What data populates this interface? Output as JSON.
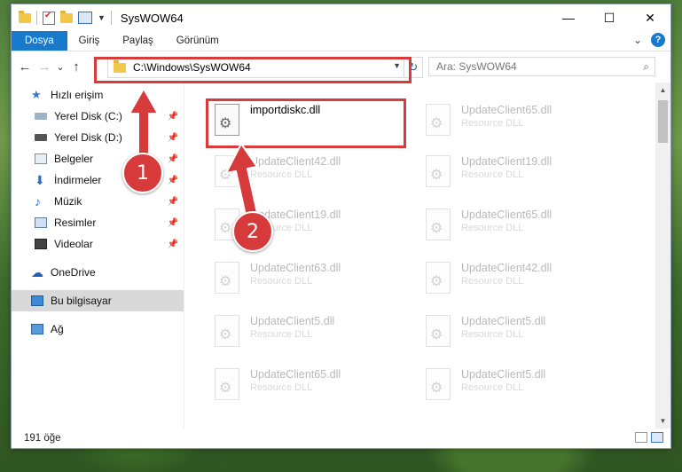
{
  "window": {
    "title": "SysWOW64",
    "controls": {
      "minimize": "—",
      "maximize": "☐",
      "close": "✕"
    }
  },
  "ribbon": {
    "tabs": [
      "Dosya",
      "Giriş",
      "Paylaş",
      "Görünüm"
    ],
    "collapse": "⌄",
    "help": "?"
  },
  "nav": {
    "back": "←",
    "forward": "→",
    "recent": "⌄",
    "up": "↑",
    "address": "C:\\Windows\\SysWOW64",
    "search_placeholder": "Ara: SysWOW64"
  },
  "sidebar": {
    "items": [
      {
        "label": "Hızlı erişim",
        "icon": "star-icon",
        "pinned": false
      },
      {
        "label": "Yerel Disk (C:)",
        "icon": "drive-icon",
        "pinned": true
      },
      {
        "label": "Yerel Disk (D:)",
        "icon": "drive-icon",
        "pinned": true
      },
      {
        "label": "Belgeler",
        "icon": "documents-icon",
        "pinned": true
      },
      {
        "label": "İndirmeler",
        "icon": "download-icon",
        "pinned": true
      },
      {
        "label": "Müzik",
        "icon": "music-icon",
        "pinned": true
      },
      {
        "label": "Resimler",
        "icon": "pictures-icon",
        "pinned": true
      },
      {
        "label": "Videolar",
        "icon": "videos-icon",
        "pinned": true
      },
      {
        "label": "OneDrive",
        "icon": "cloud-icon",
        "pinned": false
      },
      {
        "label": "Bu bilgisayar",
        "icon": "computer-icon",
        "pinned": false
      },
      {
        "label": "Ağ",
        "icon": "network-icon",
        "pinned": false
      }
    ]
  },
  "files": {
    "main": {
      "name": "importdiskc.dll",
      "type": ""
    },
    "left_column": [
      {
        "name": "UpdateClient42.dll",
        "type": "Resource DLL"
      },
      {
        "name": "UpdateClient19.dll",
        "type": "Resource DLL"
      },
      {
        "name": "UpdateClient63.dll",
        "type": "Resource DLL"
      },
      {
        "name": "UpdateClient5.dll",
        "type": "Resource DLL"
      },
      {
        "name": "UpdateClient65.dll",
        "type": "Resource DLL"
      }
    ],
    "right_column": [
      {
        "name": "UpdateClient65.dll",
        "type": "Resource DLL"
      },
      {
        "name": "UpdateClient19.dll",
        "type": "Resource DLL"
      },
      {
        "name": "UpdateClient65.dll",
        "type": "Resource DLL"
      },
      {
        "name": "UpdateClient42.dll",
        "type": "Resource DLL"
      },
      {
        "name": "UpdateClient5.dll",
        "type": "Resource DLL"
      },
      {
        "name": "UpdateClient5.dll",
        "type": "Resource DLL"
      }
    ]
  },
  "status": {
    "count": "191 öğe"
  },
  "callouts": {
    "one": "1",
    "two": "2"
  },
  "colors": {
    "accent": "#1979ca",
    "callout": "#d73a3a",
    "selection": "#d9d9d9"
  }
}
